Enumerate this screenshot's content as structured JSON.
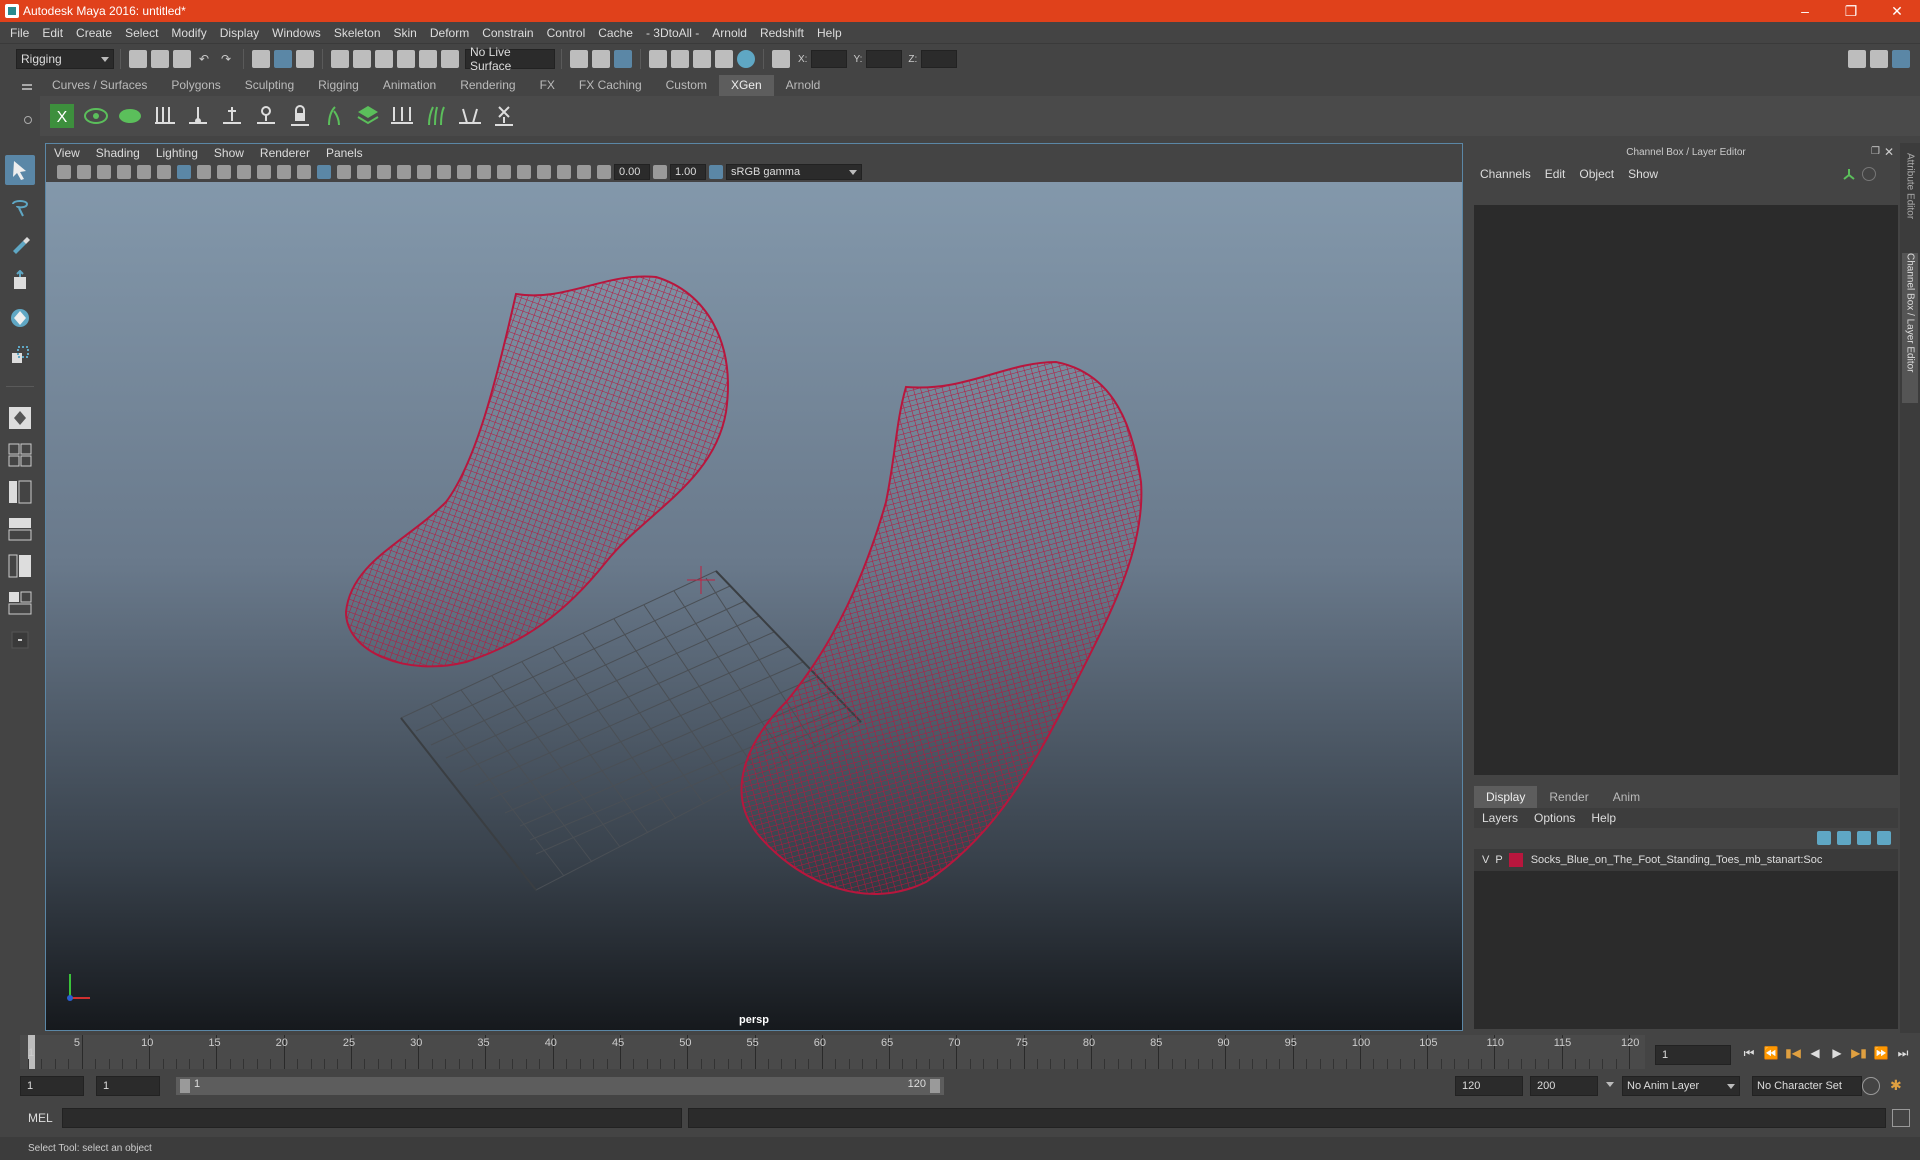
{
  "window": {
    "title": "Autodesk Maya 2016: untitled*"
  },
  "menubar": [
    "File",
    "Edit",
    "Create",
    "Select",
    "Modify",
    "Display",
    "Windows",
    "Skeleton",
    "Skin",
    "Deform",
    "Constrain",
    "Control",
    "Cache",
    "- 3DtoAll -",
    "Arnold",
    "Redshift",
    "Help"
  ],
  "statusline": {
    "menuset": "Rigging",
    "live_surface": "No Live Surface",
    "x_label": "X:",
    "y_label": "Y:",
    "z_label": "Z:"
  },
  "shelf_tabs": [
    "Curves / Surfaces",
    "Polygons",
    "Sculpting",
    "Rigging",
    "Animation",
    "Rendering",
    "FX",
    "FX Caching",
    "Custom",
    "XGen",
    "Arnold"
  ],
  "shelf_active_tab": "XGen",
  "panel_menu": [
    "View",
    "Shading",
    "Lighting",
    "Show",
    "Renderer",
    "Panels"
  ],
  "panel_tools": {
    "exposure": "0.00",
    "gamma": "1.00",
    "color_space": "sRGB gamma"
  },
  "viewport": {
    "camera": "persp",
    "wireframe_color": "#b8163d"
  },
  "channel_box": {
    "title": "Channel Box / Layer Editor",
    "menu": [
      "Channels",
      "Edit",
      "Object",
      "Show"
    ]
  },
  "layer_editor": {
    "tabs": [
      "Display",
      "Render",
      "Anim"
    ],
    "active_tab": "Display",
    "menu": [
      "Layers",
      "Options",
      "Help"
    ],
    "layers": [
      {
        "visible": "V",
        "playback": "P",
        "name": "Socks_Blue_on_The_Foot_Standing_Toes_mb_stanart:Soc",
        "color": "#b8163d"
      }
    ]
  },
  "side_tabs": [
    "Attribute Editor",
    "Channel Box / Layer Editor"
  ],
  "timeline": {
    "ticks": [
      "5",
      "10",
      "15",
      "20",
      "25",
      "30",
      "35",
      "40",
      "45",
      "50",
      "55",
      "60",
      "65",
      "70",
      "75",
      "80",
      "85",
      "90",
      "95",
      "100",
      "105",
      "110",
      "115",
      "120"
    ],
    "start_label": "1",
    "current_frame": "1"
  },
  "range": {
    "start": "1",
    "playback_start": "1",
    "slider_start": "1",
    "slider_end": "120",
    "playback_end": "120",
    "end": "200",
    "anim_layer": "No Anim Layer",
    "char_set": "No Character Set"
  },
  "command_line": {
    "label": "MEL"
  },
  "help_line": "Select Tool: select an object"
}
